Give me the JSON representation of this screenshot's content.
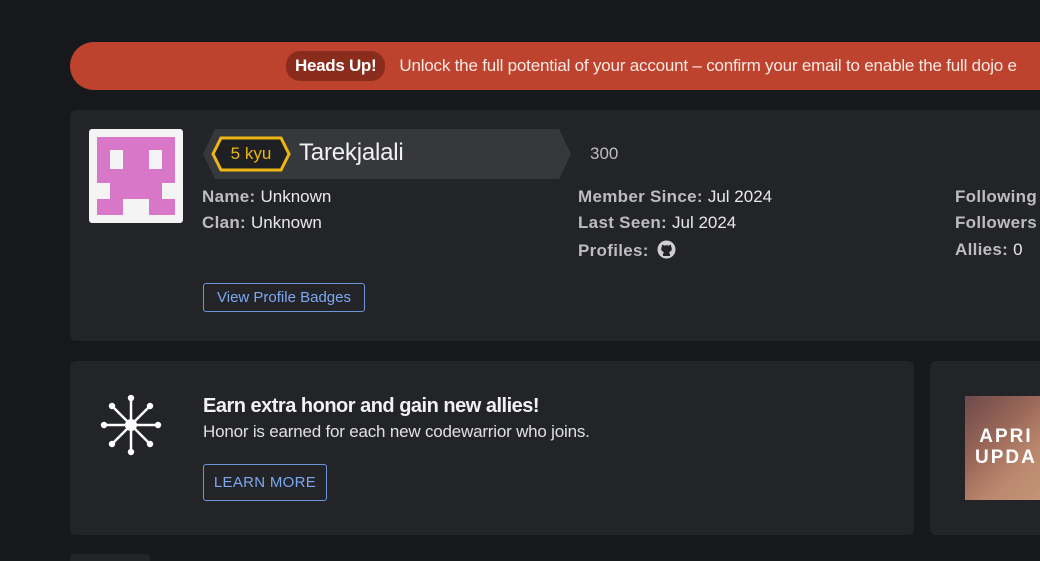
{
  "banner": {
    "badge": "Heads Up!",
    "text": "Unlock the full potential of your account – confirm your email to enable the full dojo e"
  },
  "profile": {
    "rank": "5 kyu",
    "username": "Tarekjalali",
    "honor": "300",
    "name_label": "Name:",
    "name_value": "Unknown",
    "clan_label": "Clan:",
    "clan_value": "Unknown",
    "member_since_label": "Member Since:",
    "member_since_value": "Jul 2024",
    "last_seen_label": "Last Seen:",
    "last_seen_value": "Jul 2024",
    "profiles_label": "Profiles:",
    "following_label": "Following",
    "followers_label": "Followers",
    "allies_label": "Allies:",
    "allies_value": "0",
    "badges_button": "View Profile Badges",
    "rank_color": "#ecb613",
    "avatar_color": "#d876c8"
  },
  "honor_card": {
    "title": "Earn extra honor and gain new allies!",
    "subtitle": "Honor is earned for each new codewarrior who joins.",
    "button": "LEARN MORE"
  },
  "promo": {
    "text": "APRI\nUPDA"
  },
  "colors": {
    "background": "#17181c",
    "card": "#232428",
    "banner": "#bd432e",
    "link": "#7da7f0"
  }
}
